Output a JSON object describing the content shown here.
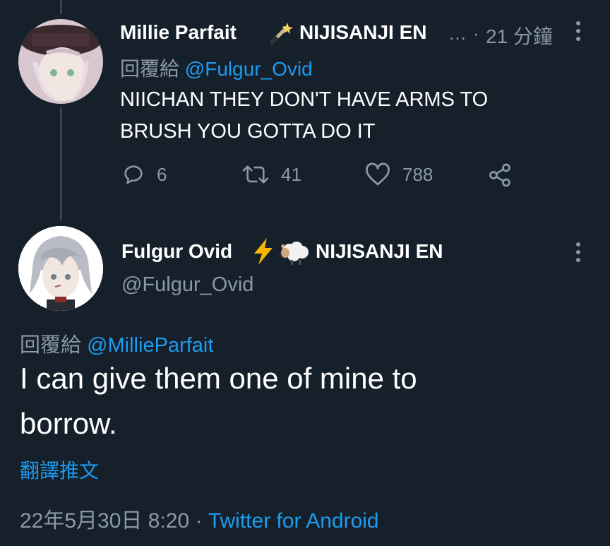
{
  "reply_tweet": {
    "display_name": "Millie Parfait",
    "badge_text": "NIJISANJI EN",
    "ellipsis": "…",
    "dot": "·",
    "time": "21 分鐘",
    "reply_prefix": "回覆給",
    "reply_handle": "@Fulgur_Ovid",
    "text_line1": "NIICHAN THEY DON'T HAVE ARMS TO",
    "text_line2": "BRUSH YOU GOTTA DO IT",
    "replies": "6",
    "retweets": "41",
    "likes": "788",
    "icons": [
      "magic-wand-icon",
      "reply-icon",
      "retweet-icon",
      "like-icon",
      "share-icon",
      "more-icon"
    ]
  },
  "main_tweet": {
    "display_name": "Fulgur Ovid",
    "badge_text": "NIJISANJI EN",
    "handle": "@Fulgur_Ovid",
    "reply_prefix": "回覆給",
    "reply_handle": "@MillieParfait",
    "text_line1": "I can give them one of mine to",
    "text_line2": "borrow.",
    "translate": "翻譯推文",
    "timestamp": "22年5月30日 8:20",
    "dot": "·",
    "source": "Twitter for Android",
    "icons": [
      "lightning-icon",
      "sheep-icon",
      "more-icon"
    ]
  },
  "colors": {
    "background": "#15202b",
    "text": "#ffffff",
    "muted": "#8b98a5",
    "link": "#1d9bf0",
    "thread_line": "#38444d"
  }
}
